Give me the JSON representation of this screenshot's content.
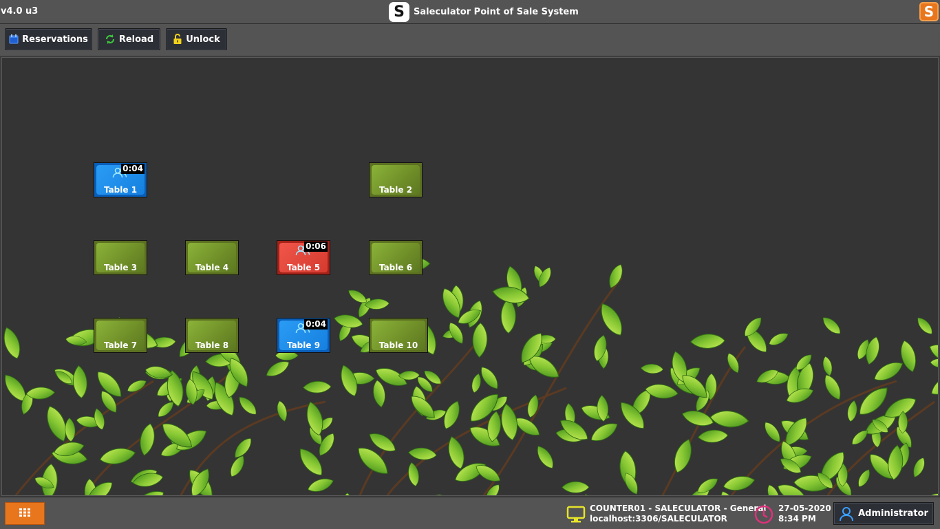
{
  "titlebar": {
    "version": "v4.0 u3",
    "logo_letter": "S",
    "title": "Saleculator Point of Sale System",
    "corner_logo_letter": "S"
  },
  "toolbar": {
    "reservations_label": "Reservations",
    "reload_label": "Reload",
    "unlock_label": "Unlock"
  },
  "tables": [
    {
      "name": "Table 1",
      "status": "occupied",
      "color": "#1680e0",
      "timer": "0:04"
    },
    {
      "name": "Table 2",
      "status": "free",
      "color": "#7aa02f",
      "timer": ""
    },
    {
      "name": "Table 3",
      "status": "free",
      "color": "#7aa02f",
      "timer": ""
    },
    {
      "name": "Table 4",
      "status": "free",
      "color": "#7aa02f",
      "timer": ""
    },
    {
      "name": "Table 5",
      "status": "occupied",
      "color": "#d63a2e",
      "timer": "0:06"
    },
    {
      "name": "Table 6",
      "status": "free",
      "color": "#7aa02f",
      "timer": ""
    },
    {
      "name": "Table 7",
      "status": "free",
      "color": "#7aa02f",
      "timer": ""
    },
    {
      "name": "Table 8",
      "status": "free",
      "color": "#7aa02f",
      "timer": ""
    },
    {
      "name": "Table 9",
      "status": "occupied",
      "color": "#1680e0",
      "timer": "0:04"
    },
    {
      "name": "Table 10",
      "status": "free",
      "color": "#7aa02f",
      "timer": ""
    }
  ],
  "statusbar": {
    "terminal_line1": "COUNTER01 - SALECULATOR - General",
    "terminal_line2": "localhost:3306/SALECULATOR",
    "date": "27-05-2020",
    "time": "8:34 PM",
    "user": "Administrator"
  },
  "icons": {
    "calendar": "calendar-icon",
    "reload": "reload-icon",
    "unlock": "padlock-icon",
    "guests": "guests-icon",
    "menu": "grid-menu-icon",
    "monitor": "monitor-icon",
    "clock": "clock-icon",
    "user": "user-icon"
  },
  "colors": {
    "accent_orange": "#e8761d",
    "occupied_blue": "#1680e0",
    "occupied_red": "#d63a2e",
    "free_green": "#7aa02f",
    "monitor_yellow": "#e6e52a",
    "clock_pink": "#e0307c",
    "user_blue": "#3aa0ff"
  }
}
